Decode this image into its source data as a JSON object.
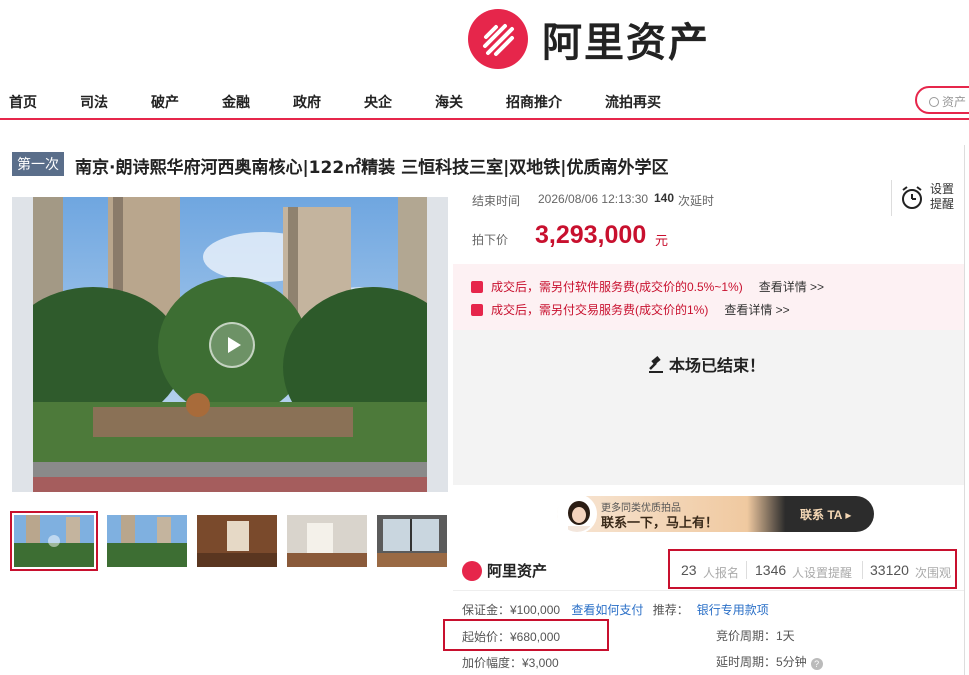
{
  "header": {
    "logo_text": "阿里资产",
    "nav": [
      "首页",
      "司法",
      "破产",
      "金融",
      "政府",
      "央企",
      "海关",
      "招商推介",
      "流拍再买"
    ],
    "search_placeholder": "资产"
  },
  "listing": {
    "badge": "第一次",
    "title": "南京·朗诗熙华府河西奥南核心|122㎡精装 三恒科技三室|双地铁|优质南外学区"
  },
  "auction": {
    "end_label": "结束时间",
    "end_time": "2026/08/06 12:13:30",
    "delay_count": "140",
    "delay_label": "次延时",
    "remind_label_1": "设置",
    "remind_label_2": "提醒",
    "price_label": "拍下价",
    "price": "3,293,000",
    "price_unit": "元",
    "fees": [
      {
        "text": "成交后，需另付软件服务费(成交价的0.5%~1%)",
        "link": "查看详情 >>"
      },
      {
        "text": "成交后，需另付交易服务费(成交价的1%)",
        "link": "查看详情 >>"
      }
    ],
    "ended_text": "本场已结束！"
  },
  "contact": {
    "small": "更多同类优质拍品",
    "big": "联系一下，马上有！",
    "button": "联系 TA ▸"
  },
  "org": {
    "name": "阿里资产"
  },
  "stats": [
    {
      "num": "23",
      "label": "人报名"
    },
    {
      "num": "1346",
      "label": "人设置提醒"
    },
    {
      "num": "33120",
      "label": "次围观"
    }
  ],
  "details": {
    "deposit": "保证金：¥100,000",
    "deposit_link": "查看如何支付",
    "recommend_label": "推荐：",
    "recommend_link": "银行专用款项",
    "start_price": "起始价：¥680,000",
    "increment": "加价幅度：¥3,000",
    "bid_cycle": "竞价周期：1天",
    "delay_cycle": "延时周期：5分钟"
  },
  "colors": {
    "brand": "#e6264b",
    "price": "#c8102e",
    "link": "#2a6fc7"
  }
}
